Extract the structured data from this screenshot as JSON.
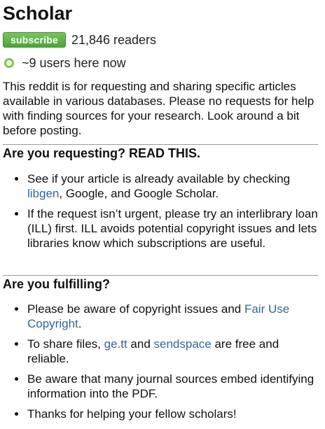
{
  "sidebar": {
    "title": "Scholar",
    "subscribe_label": "subscribe",
    "readers": "21,846 readers",
    "online": "~9 users here now",
    "description": "This reddit is for requesting and sharing specific articles available in various databases. Please no requests for help with finding sources for your research. Look around a bit before posting."
  },
  "requesting": {
    "heading": "Are you requesting? READ THIS.",
    "item1_pre": "See if your article is already available by checking ",
    "item1_link": "libgen",
    "item1_post": ", Google, and Google Scholar.",
    "item2": "If the request isn’t urgent, please try an interlibrary loan (ILL) first. ILL avoids potential copyright issues and lets libraries know which subscriptions are useful."
  },
  "fulfilling": {
    "heading": "Are you fulfilling?",
    "item1_pre": "Please be aware of copyright issues and ",
    "item1_link": "Fair Use Copyright",
    "item1_post": ".",
    "item2_pre": "To share files, ",
    "item2_link1": "ge.tt",
    "item2_mid": " and ",
    "item2_link2": "sendspace",
    "item2_post": " are free and reliable.",
    "item3": "Be aware that many journal sources embed identifying information into the PDF.",
    "item4": "Thanks for helping your fellow scholars!"
  },
  "colors": {
    "subscribe_green": "#5cb85c",
    "online_ring": "#7bc642",
    "link": "#336699"
  },
  "icons": {
    "online": "online-indicator-icon"
  }
}
